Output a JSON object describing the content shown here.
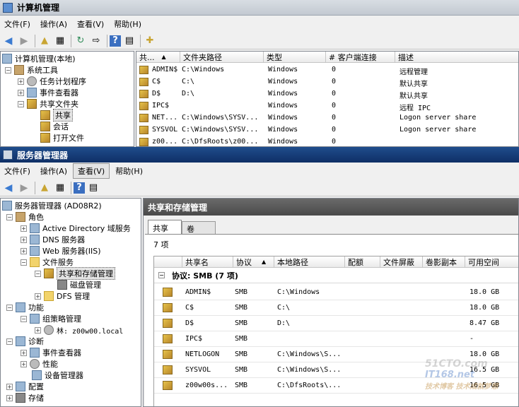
{
  "cm": {
    "title": "计算机管理",
    "menu": [
      "文件(F)",
      "操作(A)",
      "查看(V)",
      "帮助(H)"
    ],
    "tree": [
      {
        "label": "计算机管理(本地)",
        "icon": "computer-icon"
      },
      {
        "label": "系统工具",
        "icon": "tools-icon"
      },
      {
        "label": "任务计划程序",
        "icon": "clock-icon"
      },
      {
        "label": "事件查看器",
        "icon": "event-viewer-icon"
      },
      {
        "label": "共享文件夹",
        "icon": "shared-folder-icon"
      },
      {
        "label": "共享",
        "icon": "share-icon"
      },
      {
        "label": "会话",
        "icon": "session-icon"
      },
      {
        "label": "打开文件",
        "icon": "open-file-icon"
      }
    ],
    "columns": [
      "共...",
      "文件夹路径",
      "类型",
      "# 客户端连接",
      "描述"
    ],
    "rows": [
      [
        "ADMIN$",
        "C:\\Windows",
        "Windows",
        "0",
        "远程管理"
      ],
      [
        "C$",
        "C:\\",
        "Windows",
        "0",
        "默认共享"
      ],
      [
        "D$",
        "D:\\",
        "Windows",
        "0",
        "默认共享"
      ],
      [
        "IPC$",
        "",
        "Windows",
        "0",
        "远程 IPC"
      ],
      [
        "NET...",
        "C:\\Windows\\SYSV...",
        "Windows",
        "0",
        "Logon server share"
      ],
      [
        "SYSVOL",
        "C:\\Windows\\SYSV...",
        "Windows",
        "0",
        "Logon server share"
      ],
      [
        "z00...",
        "C:\\DfsRoots\\z00...",
        "Windows",
        "0",
        ""
      ]
    ]
  },
  "sm": {
    "title": "服务器管理器",
    "menu": [
      "文件(F)",
      "操作(A)",
      "查看(V)",
      "帮助(H)"
    ],
    "tree": [
      {
        "label": "服务器管理器 (AD08R2)",
        "icon": "server-manager-icon"
      },
      {
        "label": "角色",
        "icon": "roles-icon"
      },
      {
        "label": "Active Directory 域服务",
        "icon": "ad-icon"
      },
      {
        "label": "DNS 服务器",
        "icon": "dns-icon"
      },
      {
        "label": "Web 服务器(IIS)",
        "icon": "iis-icon"
      },
      {
        "label": "文件服务",
        "icon": "file-services-icon"
      },
      {
        "label": "共享和存储管理",
        "icon": "share-storage-icon"
      },
      {
        "label": "磁盘管理",
        "icon": "disk-icon"
      },
      {
        "label": "DFS 管理",
        "icon": "dfs-icon"
      },
      {
        "label": "功能",
        "icon": "features-icon"
      },
      {
        "label": "组策略管理",
        "icon": "gpo-icon"
      },
      {
        "label": "林: z00w00.local",
        "icon": "forest-icon"
      },
      {
        "label": "诊断",
        "icon": "diagnostics-icon"
      },
      {
        "label": "事件查看器",
        "icon": "event-viewer-icon"
      },
      {
        "label": "性能",
        "icon": "performance-icon"
      },
      {
        "label": "设备管理器",
        "icon": "device-manager-icon"
      },
      {
        "label": "配置",
        "icon": "config-icon"
      },
      {
        "label": "存储",
        "icon": "storage-icon"
      }
    ],
    "panel_title": "共享和存储管理",
    "tabs": [
      "共享",
      "卷"
    ],
    "count": "7 项",
    "columns": [
      "共享名",
      "协议",
      "本地路径",
      "配额",
      "文件屏蔽",
      "卷影副本",
      "可用空间"
    ],
    "group": "协议: SMB (7 项)",
    "rows": [
      [
        "ADMIN$",
        "SMB",
        "C:\\Windows",
        "18.0 GB"
      ],
      [
        "C$",
        "SMB",
        "C:\\",
        "18.0 GB"
      ],
      [
        "D$",
        "SMB",
        "D:\\",
        "8.47 GB"
      ],
      [
        "IPC$",
        "SMB",
        "",
        "-"
      ],
      [
        "NETLOGON",
        "SMB",
        "C:\\Windows\\S...",
        "18.0 GB"
      ],
      [
        "SYSVOL",
        "SMB",
        "C:\\Windows\\S...",
        "16.5 GB"
      ],
      [
        "z00w00s...",
        "SMB",
        "C:\\DfsRoots\\...",
        "16.5 GB"
      ]
    ]
  },
  "watermark": {
    "line1": "51CTO.com",
    "line2": "IT168.net",
    "line3": "技术博客",
    "line4": "技术成就梦想"
  }
}
